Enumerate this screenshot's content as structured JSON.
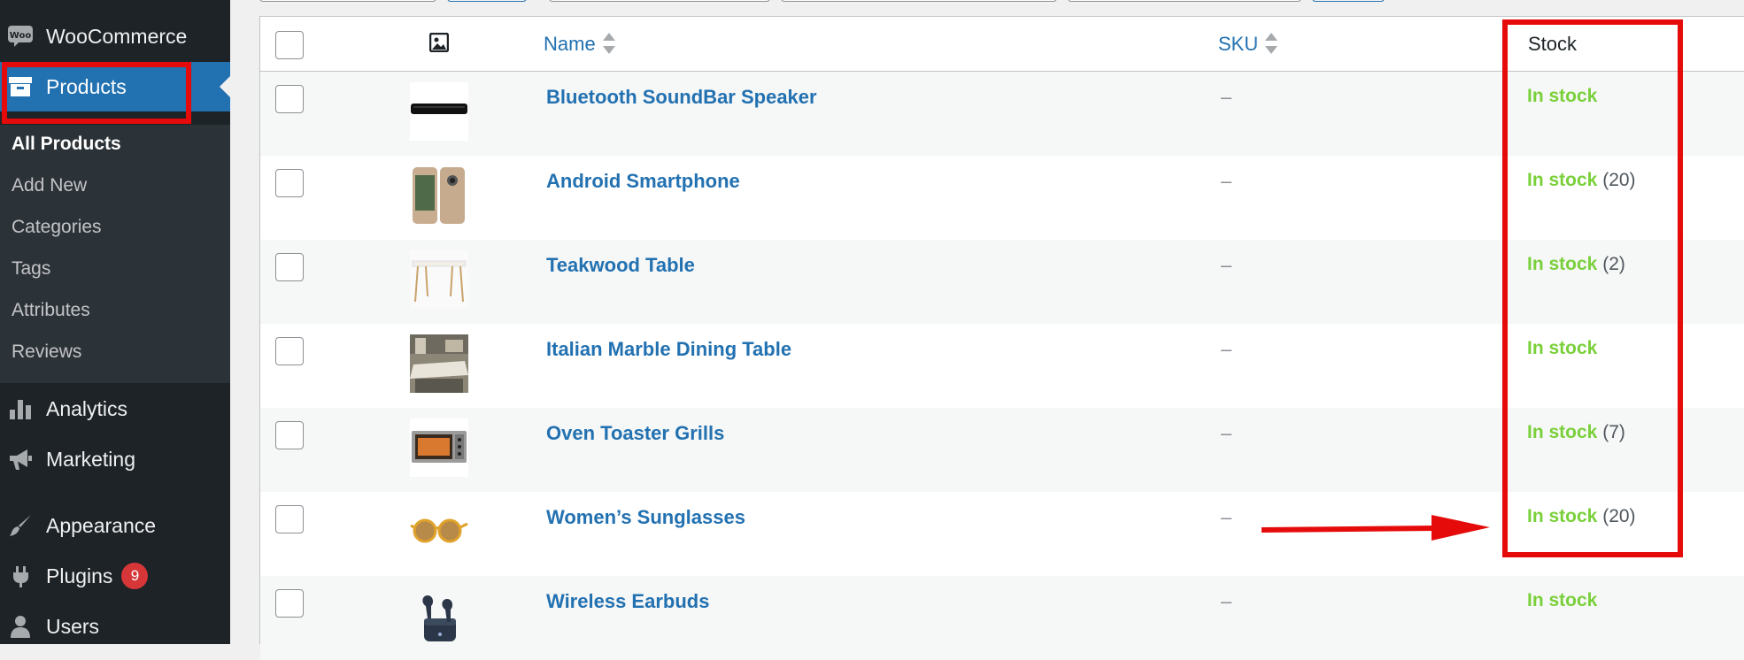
{
  "sidebar": {
    "woocommerce": {
      "label": "WooCommerce",
      "icon": "woo-icon"
    },
    "products": {
      "label": "Products",
      "icon": "archive-icon"
    },
    "submenu": [
      "All Products",
      "Add New",
      "Categories",
      "Tags",
      "Attributes",
      "Reviews"
    ],
    "analytics": {
      "label": "Analytics",
      "icon": "bar-chart-icon"
    },
    "marketing": {
      "label": "Marketing",
      "icon": "megaphone-icon"
    },
    "appearance": {
      "label": "Appearance",
      "icon": "paintbrush-icon"
    },
    "plugins": {
      "label": "Plugins",
      "icon": "plug-icon",
      "badge": "9"
    },
    "users": {
      "label": "Users",
      "icon": "user-icon"
    }
  },
  "table": {
    "columns": {
      "name": "Name",
      "sku": "SKU",
      "stock": "Stock"
    },
    "rows": [
      {
        "name": "Bluetooth SoundBar Speaker",
        "sku": "–",
        "stock": "In stock",
        "qty": ""
      },
      {
        "name": "Android Smartphone",
        "sku": "–",
        "stock": "In stock",
        "qty": "(20)"
      },
      {
        "name": "Teakwood Table",
        "sku": "–",
        "stock": "In stock",
        "qty": "(2)"
      },
      {
        "name": "Italian Marble Dining Table",
        "sku": "–",
        "stock": "In stock",
        "qty": ""
      },
      {
        "name": "Oven Toaster Grills",
        "sku": "–",
        "stock": "In stock",
        "qty": "(7)"
      },
      {
        "name": "Women’s Sunglasses",
        "sku": "–",
        "stock": "In stock",
        "qty": "(20)"
      },
      {
        "name": "Wireless Earbuds",
        "sku": "–",
        "stock": "In stock",
        "qty": ""
      }
    ]
  },
  "colors": {
    "sidebar_bg": "#1d2327",
    "accent": "#2271b1",
    "in_stock": "#7ad03a",
    "annotation_red": "#e60b0b"
  }
}
